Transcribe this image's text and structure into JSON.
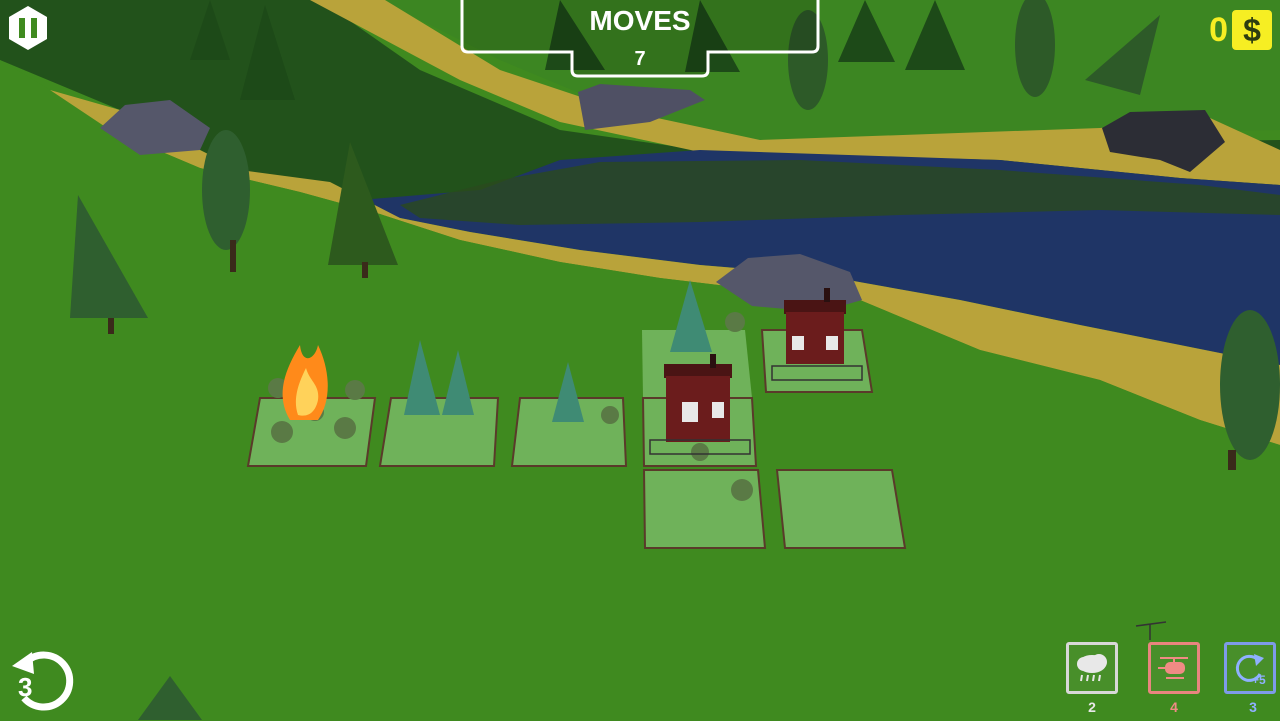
{
  "hud": {
    "moves_label": "MOVES",
    "moves_value": "7",
    "money_value": "0",
    "money_symbol": "$",
    "undo_count": "3",
    "tools": [
      {
        "name": "rain",
        "icon": "rain-cloud-icon",
        "count": "2",
        "color": "#d8d8d8"
      },
      {
        "name": "helicopter",
        "icon": "helicopter-icon",
        "count": "4",
        "color": "#e9857f"
      },
      {
        "name": "rotate",
        "icon": "rotate-plus5-icon",
        "count": "3",
        "badge": "+5",
        "color": "#7e9be8"
      }
    ]
  },
  "colors": {
    "grass": "#3f8a1f",
    "river": "#1f3566",
    "sand": "#b9a33a",
    "fire": "#ff8a1a",
    "house": "#6b1c1c",
    "money": "#f6ee23"
  }
}
